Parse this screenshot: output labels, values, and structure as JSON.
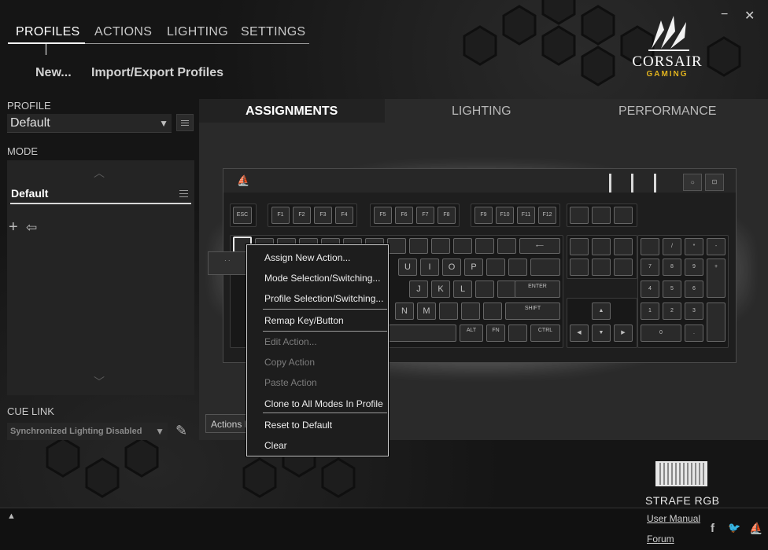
{
  "nav": {
    "tabs": [
      {
        "label": "PROFILES",
        "active": true
      },
      {
        "label": "ACTIONS"
      },
      {
        "label": "LIGHTING"
      },
      {
        "label": "SETTINGS"
      }
    ],
    "sub": {
      "new": "New...",
      "import_export": "Import/Export Profiles"
    }
  },
  "window": {
    "minimize": "−",
    "close": "✕"
  },
  "logo": {
    "brand": "CORSAIR",
    "sub": "GAMING",
    "accent": "#e0b21e"
  },
  "left": {
    "profile_label": "PROFILE",
    "profile_value": "Default",
    "mode_label": "MODE",
    "mode_value": "Default",
    "cue_link_label": "CUE LINK",
    "cue_link_value": "Synchronized Lighting Disabled"
  },
  "main": {
    "tabs": [
      {
        "label": "ASSIGNMENTS",
        "active": true
      },
      {
        "label": "LIGHTING"
      },
      {
        "label": "PERFORMANCE"
      }
    ],
    "actions_button": "Actions List"
  },
  "keyboard": {
    "fn_row": [
      "ESC",
      "F1",
      "F2",
      "F3",
      "F4",
      "F5",
      "F6",
      "F7",
      "F8",
      "F9",
      "F10",
      "F11",
      "F12"
    ],
    "visible_keys": {
      "u": "U",
      "i": "I",
      "o": "O",
      "p": "P",
      "j": "J",
      "k": "K",
      "l": "L",
      "n": "N",
      "m": "M",
      "enter": "ENTER",
      "shift": "SHIFT",
      "alt": "ALT",
      "fn": "FN",
      "ctrl": "CTRL",
      "zero": "0"
    }
  },
  "context_menu": {
    "items": [
      {
        "label": "Assign New Action...",
        "enabled": true
      },
      {
        "label": "Mode Selection/Switching...",
        "enabled": true
      },
      {
        "label": "Profile Selection/Switching...",
        "enabled": true
      },
      {
        "label": "Remap Key/Button",
        "enabled": true
      },
      {
        "label": "Edit Action...",
        "enabled": false
      },
      {
        "label": "Copy Action",
        "enabled": false
      },
      {
        "label": "Paste Action",
        "enabled": false
      },
      {
        "label": "Clone to All Modes In Profile",
        "enabled": true
      },
      {
        "label": "Reset to Default",
        "enabled": true
      },
      {
        "label": "Clear",
        "enabled": true
      }
    ]
  },
  "device": {
    "name": "STRAFE RGB"
  },
  "links": {
    "manual": "User Manual",
    "forum": "Forum"
  },
  "social": {
    "facebook": "f",
    "twitter": "🐦",
    "corsair": "⛵"
  }
}
